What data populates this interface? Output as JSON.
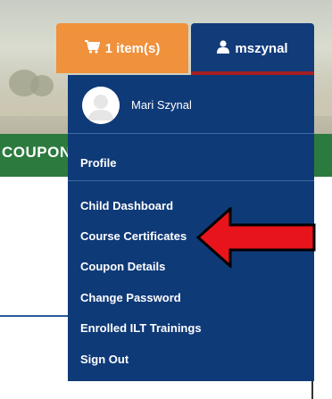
{
  "header": {
    "banner_label": "COUPON"
  },
  "cart_button": {
    "label": "1 item(s)",
    "icon": "shopping-cart-icon",
    "color": "#f0913c"
  },
  "user_button": {
    "label": "mszynal",
    "icon": "user-icon",
    "color": "#123b7a"
  },
  "dropdown": {
    "user_name": "Mari Szynal",
    "items": [
      {
        "label": "Profile"
      },
      {
        "label": "Child Dashboard"
      },
      {
        "label": "Course Certificates"
      },
      {
        "label": "Coupon Details"
      },
      {
        "label": "Change Password"
      },
      {
        "label": "Enrolled ILT Trainings"
      },
      {
        "label": "Sign Out"
      }
    ]
  },
  "annotation": {
    "arrow_color": "#e8141c",
    "points_to": "Course Certificates"
  }
}
